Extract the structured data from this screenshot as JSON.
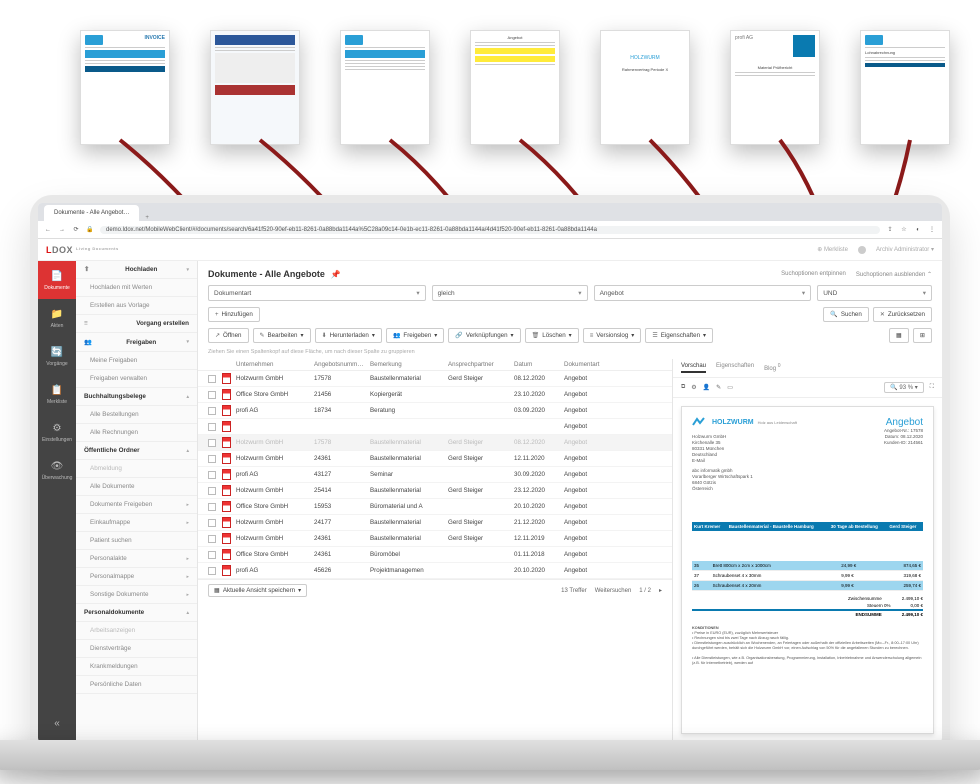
{
  "browser": {
    "tab_title": "Dokumente - Alle Angebot…",
    "url": "demo.ldox.net/MobileWebClient/#/documents/search/6a41f520-90ef-eb11-8261-0a88bda1144a%5C28a09c14-0e1b-ec11-8261-0a88bda1144a/4d41f520-90ef-eb11-8261-0a88bda1144a"
  },
  "brand": {
    "l": "L",
    "dox": "DOX",
    "sub": "Living\nDocuments"
  },
  "header": {
    "merkliste": "Merkliste",
    "user": "Archiv Administrator"
  },
  "rail": [
    {
      "icon": "📄",
      "label": "Dokumente",
      "active": true
    },
    {
      "icon": "📁",
      "label": "Akten"
    },
    {
      "icon": "🔄",
      "label": "Vorgänge"
    },
    {
      "icon": "📋",
      "label": "Merkliste"
    },
    {
      "icon": "⚙",
      "label": "Einstellungen"
    },
    {
      "icon": "👁",
      "label": "Überwachung"
    }
  ],
  "sidebar": {
    "items": [
      {
        "label": "Hochladen",
        "head": true,
        "icon": "⬆",
        "chev": "▾"
      },
      {
        "label": "Hochladen mit Werten",
        "sub": true
      },
      {
        "label": "Erstellen aus Vorlage",
        "sub": true
      },
      {
        "label": "Vorgang erstellen",
        "head": true,
        "icon": "≡"
      },
      {
        "label": "Freigaben",
        "head": true,
        "icon": "👥",
        "chev": "▾"
      },
      {
        "label": "Meine Freigaben",
        "sub": true
      },
      {
        "label": "Freigaben verwalten",
        "sub": true
      },
      {
        "label": "Buchhaltungsbelege",
        "head": true,
        "chev": "▴"
      },
      {
        "label": "Alle Bestellungen",
        "sub": true
      },
      {
        "label": "Alle Rechnungen",
        "sub": true
      },
      {
        "label": "Öffentliche Ordner",
        "head": true,
        "chev": "▴"
      },
      {
        "label": "Abmeldung",
        "sub": true,
        "muted": true
      },
      {
        "label": "Alle Dokumente",
        "sub": true
      },
      {
        "label": "Dokumente Freigeben",
        "sub": true,
        "chev": "▸"
      },
      {
        "label": "Einkaufmappe",
        "sub": true,
        "chev": "▸"
      },
      {
        "label": "Patient suchen",
        "sub": true
      },
      {
        "label": "Personalakte",
        "sub": true,
        "chev": "▸"
      },
      {
        "label": "Personalmappe",
        "sub": true,
        "chev": "▸"
      },
      {
        "label": "Sonstige Dokumente",
        "sub": true,
        "chev": "▸"
      },
      {
        "label": "Personaldokumente",
        "head": true,
        "chev": "▴"
      },
      {
        "label": "Arbeitsanzeigen",
        "sub": true,
        "muted": true
      },
      {
        "label": "Dienstverträge",
        "sub": true
      },
      {
        "label": "Krankmeldungen",
        "sub": true
      },
      {
        "label": "Persönliche Daten",
        "sub": true
      }
    ]
  },
  "page": {
    "title": "Dokumente - Alle Angebote",
    "opt_collapse": "Suchoptionen entpinnen",
    "opt_hide": "Suchoptionen ausblenden"
  },
  "filter": {
    "field": "Dokumentart",
    "op": "gleich",
    "value": "Angebot",
    "logic": "UND"
  },
  "buttons": {
    "add": "Hinzufügen",
    "search": "Suchen",
    "reset": "Zurücksetzen",
    "open": "Öffnen",
    "edit": "Bearbeiten",
    "download": "Herunterladen",
    "share": "Freigeben",
    "links": "Verknüpfungen",
    "delete": "Löschen",
    "versions": "Versionslog",
    "props": "Eigenschaften"
  },
  "group_hint": "Ziehen Sie einen Spaltenkopf auf diese Fläche, um nach dieser Spalte zu gruppieren",
  "columns": [
    "Unternehmen",
    "Angebotsnumm…",
    "Bemerkung",
    "Ansprechpartner",
    "Datum",
    "Dokumentart"
  ],
  "rows": [
    {
      "u": "Holzwurm GmbH",
      "n": "17578",
      "b": "Baustellenmaterial",
      "a": "Gerd Steiger",
      "d": "08.12.2020",
      "t": "Angebot"
    },
    {
      "u": "Office Store GmbH",
      "n": "21456",
      "b": "Kopiergerät",
      "a": "",
      "d": "23.10.2020",
      "t": "Angebot"
    },
    {
      "u": "profi AG",
      "n": "18734",
      "b": "Beratung",
      "a": "",
      "d": "03.09.2020",
      "t": "Angebot"
    },
    {
      "u": "",
      "n": "",
      "b": "",
      "a": "",
      "d": "",
      "t": "Angebot"
    },
    {
      "u": "Holzwurm GmbH",
      "n": "17578",
      "b": "Baustellenmaterial",
      "a": "Gerd Steiger",
      "d": "08.12.2020",
      "t": "Angebot",
      "selected": true
    },
    {
      "u": "Holzwurm GmbH",
      "n": "24361",
      "b": "Baustellenmaterial",
      "a": "Gerd Steiger",
      "d": "12.11.2020",
      "t": "Angebot"
    },
    {
      "u": "profi AG",
      "n": "43127",
      "b": "Seminar",
      "a": "",
      "d": "30.09.2020",
      "t": "Angebot"
    },
    {
      "u": "Holzwurm GmbH",
      "n": "25414",
      "b": "Baustellenmaterial",
      "a": "Gerd Steiger",
      "d": "23.12.2020",
      "t": "Angebot"
    },
    {
      "u": "Office Store GmbH",
      "n": "15953",
      "b": "Büromaterial und A",
      "a": "",
      "d": "20.10.2020",
      "t": "Angebot"
    },
    {
      "u": "Holzwurm GmbH",
      "n": "24177",
      "b": "Baustellenmaterial",
      "a": "Gerd Steiger",
      "d": "21.12.2020",
      "t": "Angebot"
    },
    {
      "u": "Holzwurm GmbH",
      "n": "24361",
      "b": "Baustellenmaterial",
      "a": "Gerd Steiger",
      "d": "12.11.2019",
      "t": "Angebot"
    },
    {
      "u": "Office Store GmbH",
      "n": "24361",
      "b": "Büromöbel",
      "a": "",
      "d": "01.11.2018",
      "t": "Angebot"
    },
    {
      "u": "profi AG",
      "n": "45626",
      "b": "Projektmanagemen",
      "a": "",
      "d": "20.10.2020",
      "t": "Angebot"
    }
  ],
  "footer": {
    "save_view": "Aktuelle Ansicht speichern",
    "hits": "13 Treffer",
    "next": "Weitersuchen",
    "page": "1 / 2"
  },
  "preview": {
    "tabs": [
      "Vorschau",
      "Eigenschaften",
      "Blog"
    ],
    "zoom": "93 %",
    "badge": "0",
    "doc": {
      "company": "HOLZWURM",
      "tag": "Holz aus Leidenschaft",
      "title": "Angebot",
      "from": [
        "Holzwurm GmbH",
        "Kirchenalle 35",
        "80331 München",
        "Deutschland",
        "E-Mail"
      ],
      "to": [
        "abc informatik gmbh",
        "Vorarlberger Wirtschaftspark 1",
        "6840 Götzis",
        "Österreich"
      ],
      "meta": [
        "Angebot-Nr.: 17578",
        "Datum: 08.12.2020",
        "Kunden-ID: 214561"
      ],
      "cols": [
        "Kurt Kremer",
        "Baustellenmaterial - Baustelle Hamburg",
        "30 Tage ab Bestellung",
        "Gerd Steiger"
      ],
      "lines": [
        {
          "p": "35",
          "d": "Brett 800cm x 2cm x 1000cm",
          "q": "24,99 €",
          "s": "874,65 €"
        },
        {
          "p": "37",
          "d": "Schraubenset  4 x 30mm",
          "q": "9,99 €",
          "s": "319,68 €"
        },
        {
          "p": "26",
          "d": "Schraubenset 4 x 20mm",
          "q": "9,99 €",
          "s": "259,74 €"
        }
      ],
      "subtotal_l": "Zwischensumme",
      "subtotal": "2.499,10 €",
      "tax_l": "Steuern 0%",
      "tax": "0,00 €",
      "total_l": "ENDSUMME",
      "total": "2.499,10 €",
      "terms_h": "KONDITIONEN",
      "terms": "• Preise in EURO (EUR), zuzüglich Mehrwertsteuer\\n• Rechnungen sind bis zwei Tage nach Abzug rasch fällig.\\n• Dienstleistungen ausdrücklich an Wochenenden, an Feiertagen oder außerhalb der offiziellen Arbeitszeiten (Mo.–Fr., 8:00–17:00 Uhr) durchgeführt werden, behält sich die Holzwurm GmbH vor, einen Aufschlag von 50% für die angefallenen Stunden zu berechnen.\\n\\n• Alle Dienstleistungen, wie z.B. Organisationsberatung, Programmierung, Installation, Inbetriebnahme und Anwenderschulung allgemein (z.B. für Internetbetrieb), werden auf"
    }
  }
}
